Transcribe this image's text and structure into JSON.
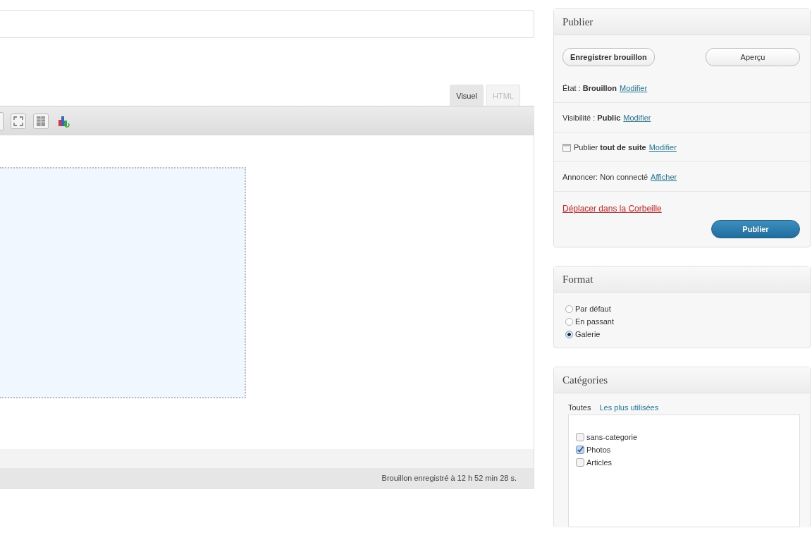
{
  "editor": {
    "tabs": [
      {
        "label": "Visuel",
        "selected": true
      },
      {
        "label": "HTML",
        "selected": false
      }
    ],
    "status": "Brouillon enregistré à 12 h 52 min 28 s."
  },
  "publish": {
    "title": "Publier",
    "save_draft": "Enregistrer brouillon",
    "preview": "Aperçu",
    "rows": [
      {
        "kind": "plain",
        "text": "État : **Brouillon**",
        "link": "Modifier"
      },
      {
        "kind": "plain",
        "text": "Visibilité : **Public**",
        "link": "Modifier"
      },
      {
        "kind": "schedule",
        "text": "Publier **tout de suite**",
        "link": "Modifier"
      },
      {
        "kind": "plain",
        "text": "Annoncer: Non connecté",
        "link": "Afficher"
      }
    ],
    "trash": "Déplacer dans la Corbeille",
    "publish_button": "Publier"
  },
  "format": {
    "title": "Format",
    "options": [
      {
        "label": "Par défaut",
        "selected": false
      },
      {
        "label": "En passant",
        "selected": false
      },
      {
        "label": "Galerie",
        "selected": true
      }
    ]
  },
  "categories": {
    "title": "Catégories",
    "tabs": [
      {
        "label": "Toutes",
        "selected": true
      },
      {
        "label": "Les plus utilisées",
        "selected": false
      }
    ],
    "items": [
      {
        "label": "sans-categorie",
        "checked": false
      },
      {
        "label": "Photos",
        "checked": true
      },
      {
        "label": "Articles",
        "checked": false
      }
    ]
  }
}
